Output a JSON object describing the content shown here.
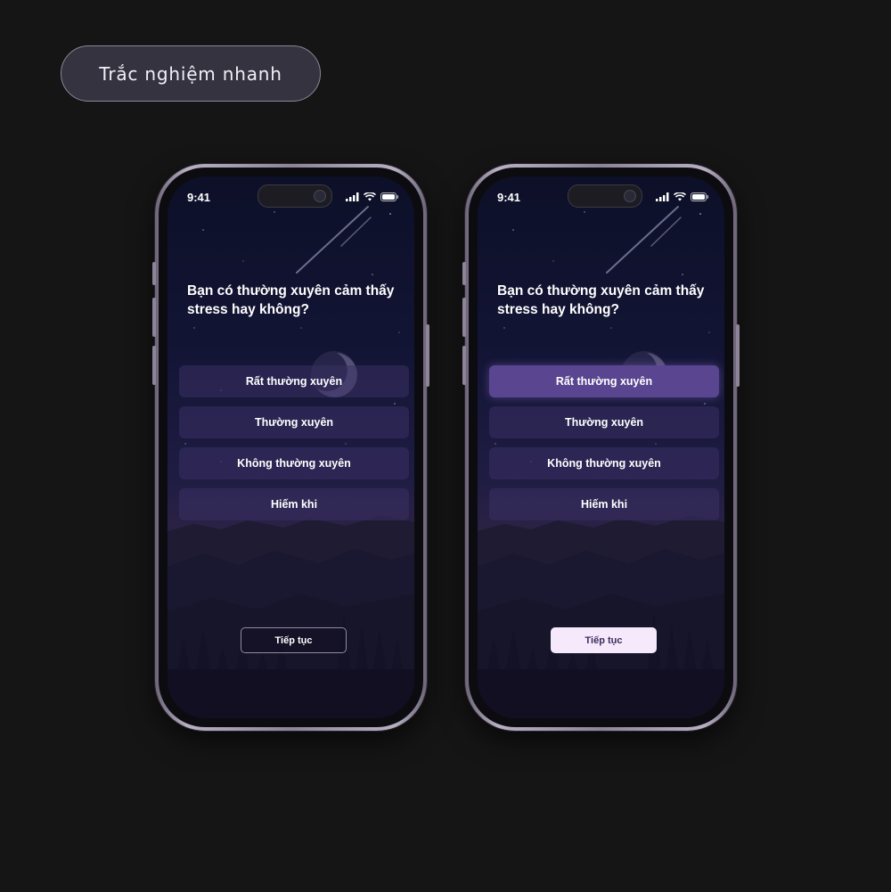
{
  "section": {
    "title": "Trắc nghiệm nhanh"
  },
  "colors": {
    "background": "#151515",
    "accent_selected": "#5a4590",
    "button_filled": "#f5e9fb"
  },
  "phones": [
    {
      "status": {
        "time": "9:41",
        "icons": [
          "signal-icon",
          "wifi-icon",
          "battery-icon"
        ]
      },
      "question": "Bạn có thường xuyên cảm thấy stress hay không?",
      "options": [
        {
          "label": "Rất thường xuyên",
          "selected": false
        },
        {
          "label": "Thường xuyên",
          "selected": false
        },
        {
          "label": "Không thường xuyên",
          "selected": false
        },
        {
          "label": "Hiếm khi",
          "selected": false
        }
      ],
      "continue_label": "Tiếp tục",
      "continue_enabled": false
    },
    {
      "status": {
        "time": "9:41",
        "icons": [
          "signal-icon",
          "wifi-icon",
          "battery-icon"
        ]
      },
      "question": "Bạn có thường xuyên cảm thấy stress hay không?",
      "options": [
        {
          "label": "Rất thường xuyên",
          "selected": true
        },
        {
          "label": "Thường xuyên",
          "selected": false
        },
        {
          "label": "Không thường xuyên",
          "selected": false
        },
        {
          "label": "Hiếm khi",
          "selected": false
        }
      ],
      "continue_label": "Tiếp tục",
      "continue_enabled": true
    }
  ]
}
